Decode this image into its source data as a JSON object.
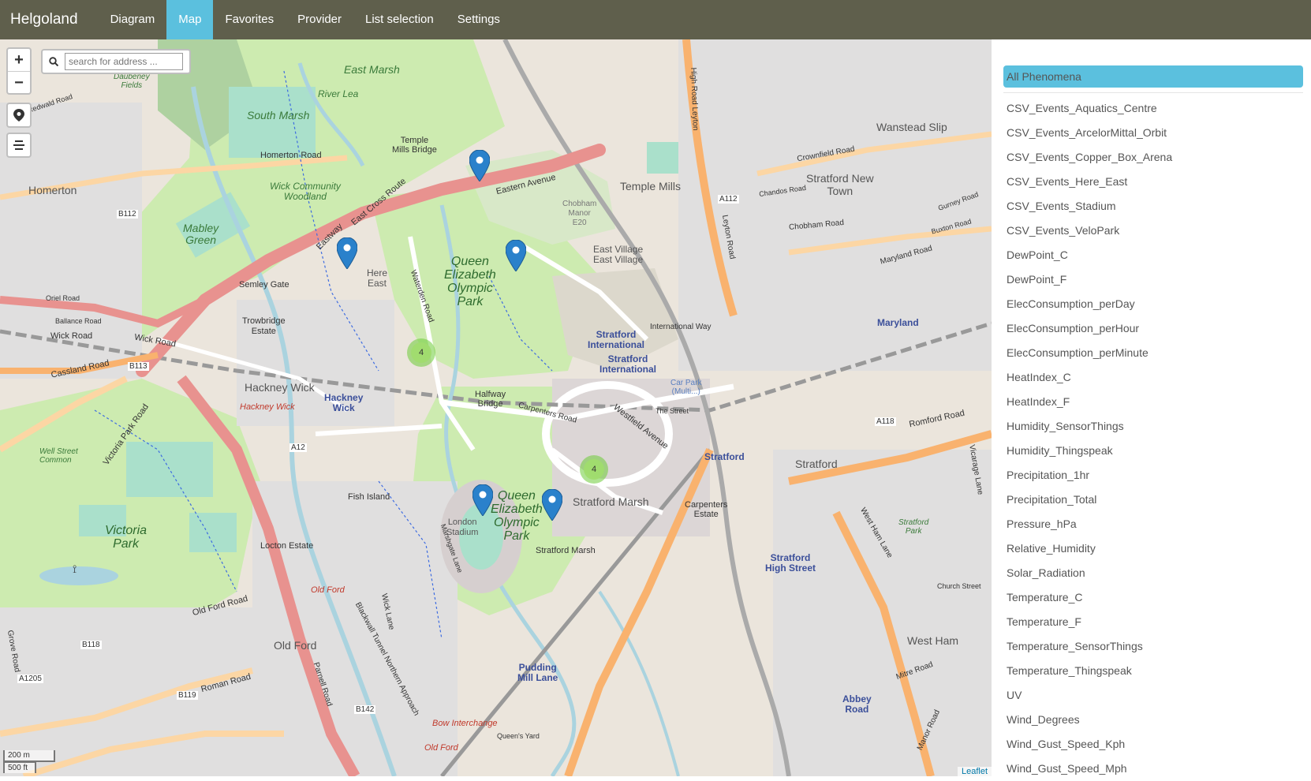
{
  "app": {
    "brand": "Helgoland"
  },
  "nav": {
    "items": [
      {
        "label": "Diagram"
      },
      {
        "label": "Map",
        "active": true
      },
      {
        "label": "Favorites"
      },
      {
        "label": "Provider"
      },
      {
        "label": "List selection"
      },
      {
        "label": "Settings"
      }
    ]
  },
  "map": {
    "search_placeholder": "search for address ...",
    "zoom_in": "+",
    "zoom_out": "−",
    "clusters": [
      "4",
      "4"
    ],
    "scale": {
      "metric": "200 m",
      "imperial": "500 ft"
    },
    "attribution": "Leaflet",
    "labels": {
      "homerton": "Homerton",
      "east_marsh": "East Marsh",
      "south_marsh": "South Marsh",
      "river_lea": "River Lea",
      "temple_mills_bridge": "Temple\nMills Bridge",
      "eastern_avenue": "Eastern Avenue",
      "homerton_road": "Homerton Road",
      "wick_woodland": "Wick Community\nWoodland",
      "mabley_green": "Mabley\nGreen",
      "here_east": "Here\nEast",
      "qeop": "Queen\nElizabeth\nOlympic\nPark",
      "qeop2": "Queen\nElizabeth\nOlympic\nPark",
      "chobham_manor": "Chobham\nManor\nE20",
      "east_village": "East Village\nEast Village",
      "temple_mills": "Temple Mills",
      "stratford_new_town": "Stratford New\nTown",
      "wanstead_slip": "Wanstead Slip",
      "maryland": "Maryland",
      "stratford_intl": "Stratford\nInternational",
      "stratford_intl2": "Stratford\nInternational",
      "international_way": "International Way",
      "hackney_wick": "Hackney Wick",
      "hackney_wick_station": "Hackney\nWick",
      "hackney_wick_red": "Hackney Wick",
      "trowbridge_estate": "Trowbridge\nEstate",
      "semley_gate": "Semley Gate",
      "halfway_bridge": "Halfway\nBridge",
      "stratford": "Stratford",
      "stratford_station": "Stratford",
      "stratford_marsh": "Stratford Marsh",
      "stratford_marsh2": "Stratford Marsh",
      "carpenters_estate": "Carpenters\nEstate",
      "stratford_high_street": "Stratford\nHigh Street",
      "london_stadium": "London\nStadium",
      "fish_island": "Fish Island",
      "victoria_park": "Victoria\nPark",
      "well_street_common": "Well Street\nCommon",
      "locton_estate": "Locton Estate",
      "old_ford": "Old Ford",
      "old_ford_red": "Old Ford",
      "old_ford_red2": "Old Ford",
      "pudding_mill_lane": "Pudding\nMill Lane",
      "abbey_road": "Abbey\nRoad",
      "west_ham": "West Ham",
      "stratford_park": "Stratford\nPark",
      "bow_interchange": "Bow Interchange",
      "the_street": "The Street",
      "car_park": "Car Park\n(Multi...)",
      "wick_road": "Wick Road",
      "wick_road2": "Wick Road",
      "cassland_road": "Cassland Road",
      "victoria_park_road": "Victoria Park Road",
      "romford_road": "Romford Road",
      "roman_road": "Roman Road",
      "old_ford_road": "Old Ford Road",
      "east_cross_route": "East Cross Route",
      "eastway": "Eastway",
      "westfield_avenue": "Westfield Avenue",
      "carpenters_road": "Carpenters Road",
      "waterden_road": "Waterden Road",
      "a12": "A12",
      "a112": "A112",
      "a118": "A118",
      "b112": "B112",
      "b113": "B113",
      "b118": "B118",
      "b119": "B119",
      "b142": "B142",
      "a1205": "A1205",
      "leyton_road": "Leyton Road",
      "high_road_leyton": "High Road Leyton",
      "west_ham_lane": "West Ham Lane",
      "church_street": "Church Street",
      "mitre_road": "Mitre Road",
      "chobham_road": "Chobham Road",
      "maryland_road": "Maryland Road",
      "crownfield_road": "Crownfield Road",
      "chandos_road": "Chandos Road",
      "gurney_road": "Gurney Road",
      "buxton_road": "Buxton Road",
      "vicarage_lane": "Vicarage Lane",
      "ballance_road": "Ballance Road",
      "orriel_road": "Oriel Road",
      "redwald_road": "Redwald Road",
      "daubeney_fields": "Daubeney\nFields",
      "manor_road": "Manor Road",
      "marshgate_lane": "Marshgate Lane",
      "blackwall_tunnel": "Blackwall Tunnel Northern Approach",
      "parnell_road": "Parnell Road",
      "wick_lane": "Wick Lane",
      "grove_road": "Grove Road",
      "queens_yard": "Queen's Yard"
    }
  },
  "sidebar": {
    "header": "All Phenomena",
    "phenomena": [
      "CSV_Events_Aquatics_Centre",
      "CSV_Events_ArcelorMittal_Orbit",
      "CSV_Events_Copper_Box_Arena",
      "CSV_Events_Here_East",
      "CSV_Events_Stadium",
      "CSV_Events_VeloPark",
      "DewPoint_C",
      "DewPoint_F",
      "ElecConsumption_perDay",
      "ElecConsumption_perHour",
      "ElecConsumption_perMinute",
      "HeatIndex_C",
      "HeatIndex_F",
      "Humidity_SensorThings",
      "Humidity_Thingspeak",
      "Precipitation_1hr",
      "Precipitation_Total",
      "Pressure_hPa",
      "Relative_Humidity",
      "Solar_Radiation",
      "Temperature_C",
      "Temperature_F",
      "Temperature_SensorThings",
      "Temperature_Thingspeak",
      "UV",
      "Wind_Degrees",
      "Wind_Gust_Speed_Kph",
      "Wind_Gust_Speed_Mph"
    ]
  },
  "colors": {
    "navbar": "#5f5f4c",
    "accent": "#5bc0de",
    "marker": "#2a81cb",
    "park": "#cdebb0",
    "motorway": "#e8928f",
    "primary_road": "#f9b26e",
    "water": "#aad3df"
  }
}
